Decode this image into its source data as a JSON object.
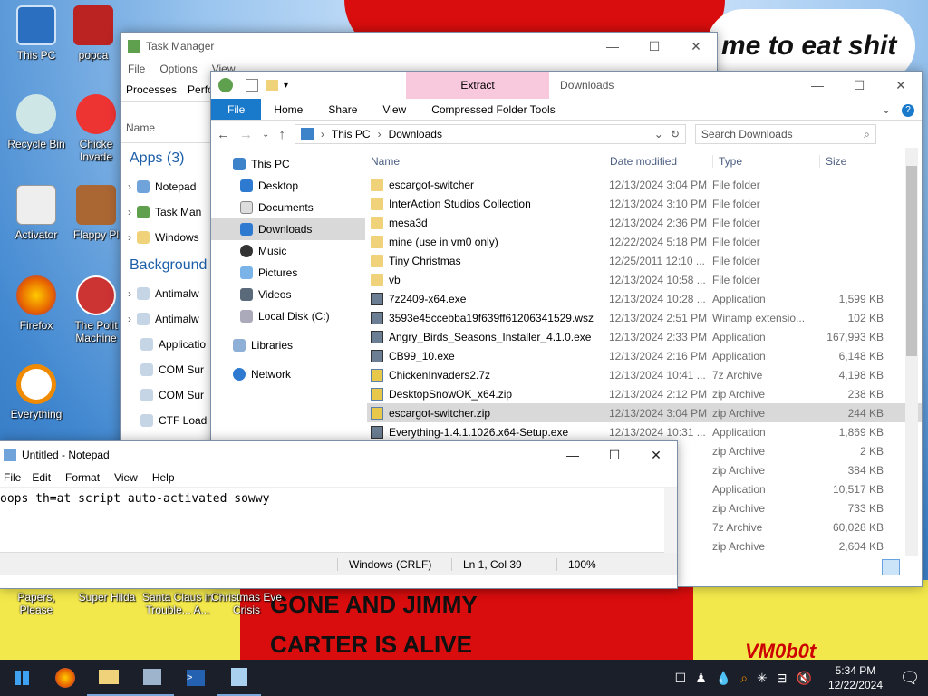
{
  "wallpaper": {
    "top_text": "me to eat shit",
    "line1": "GONE AND JIMMY",
    "line2": "CARTER IS ALIVE",
    "signature": "VM0b0t"
  },
  "desktop_icons": [
    {
      "label": "This PC",
      "icon": "computer-icon",
      "color": "#2b6fc0"
    },
    {
      "label": "popca",
      "icon": "popcap-icon",
      "color": "#b22"
    },
    {
      "label": "Recycle Bin",
      "icon": "recycle-bin-icon",
      "color": "#9cc"
    },
    {
      "label": "Chicke Invade",
      "icon": "chicken-invaders-icon",
      "color": "#e33"
    },
    {
      "label": "Activator",
      "icon": "activator-icon",
      "color": "#ddd"
    },
    {
      "label": "Flappy Pl",
      "icon": "flappy-icon",
      "color": "#a63"
    },
    {
      "label": "Firefox",
      "icon": "firefox-icon",
      "color": "#e66000"
    },
    {
      "label": "The Polit Machine",
      "icon": "political-machine-icon",
      "color": "#c33"
    },
    {
      "label": "Everything",
      "icon": "everything-icon",
      "color": "#f08a00"
    }
  ],
  "bottom_icons": [
    "Papers, Please",
    "Super Hilda",
    "Santa Claus in Trouble... A...",
    "Christmas Eve Crisis"
  ],
  "task_manager": {
    "title": "Task Manager",
    "menu": [
      "File",
      "Options",
      "View"
    ],
    "tabs": [
      "Processes",
      "Perfo"
    ],
    "col_name": "Name",
    "apps_header": "Apps (3)",
    "apps": [
      "Notepad",
      "Task Man",
      "Windows"
    ],
    "bg_header": "Background",
    "bg": [
      "Antimalw",
      "Antimalw",
      "Applicatio",
      "COM Sur",
      "COM Sur",
      "CTF Load"
    ]
  },
  "explorer": {
    "title": "Downloads",
    "context_tab": "Extract",
    "tabs": {
      "file": "File",
      "home": "Home",
      "share": "Share",
      "view": "View",
      "tools": "Compressed Folder Tools"
    },
    "path": [
      "This PC",
      "Downloads"
    ],
    "search_placeholder": "Search Downloads",
    "nav": [
      "This PC",
      "Desktop",
      "Documents",
      "Downloads",
      "Music",
      "Pictures",
      "Videos",
      "Local Disk (C:)",
      "Libraries",
      "Network"
    ],
    "headers": {
      "name": "Name",
      "date": "Date modified",
      "type": "Type",
      "size": "Size"
    },
    "files": [
      {
        "name": "escargot-switcher",
        "date": "12/13/2024 3:04 PM",
        "type": "File folder",
        "size": "",
        "kind": "folder"
      },
      {
        "name": "InterAction Studios Collection",
        "date": "12/13/2024 3:10 PM",
        "type": "File folder",
        "size": "",
        "kind": "folder"
      },
      {
        "name": "mesa3d",
        "date": "12/13/2024 2:36 PM",
        "type": "File folder",
        "size": "",
        "kind": "folder"
      },
      {
        "name": "mine (use in vm0 only)",
        "date": "12/22/2024 5:18 PM",
        "type": "File folder",
        "size": "",
        "kind": "folder"
      },
      {
        "name": "Tiny Christmas",
        "date": "12/25/2011 12:10 ...",
        "type": "File folder",
        "size": "",
        "kind": "folder"
      },
      {
        "name": "vb",
        "date": "12/13/2024 10:58 ...",
        "type": "File folder",
        "size": "",
        "kind": "folder"
      },
      {
        "name": "7z2409-x64.exe",
        "date": "12/13/2024 10:28 ...",
        "type": "Application",
        "size": "1,599 KB",
        "kind": "app"
      },
      {
        "name": "3593e45ccebba19f639ff61206341529.wsz",
        "date": "12/13/2024 2:51 PM",
        "type": "Winamp extensio...",
        "size": "102 KB",
        "kind": "app"
      },
      {
        "name": "Angry_Birds_Seasons_Installer_4.1.0.exe",
        "date": "12/13/2024 2:33 PM",
        "type": "Application",
        "size": "167,993 KB",
        "kind": "app"
      },
      {
        "name": "CB99_10.exe",
        "date": "12/13/2024 2:16 PM",
        "type": "Application",
        "size": "6,148 KB",
        "kind": "app"
      },
      {
        "name": "ChickenInvaders2.7z",
        "date": "12/13/2024 10:41 ...",
        "type": "7z Archive",
        "size": "4,198 KB",
        "kind": "zip"
      },
      {
        "name": "DesktopSnowOK_x64.zip",
        "date": "12/13/2024 2:12 PM",
        "type": "zip Archive",
        "size": "238 KB",
        "kind": "zip"
      },
      {
        "name": "escargot-switcher.zip",
        "date": "12/13/2024 3:04 PM",
        "type": "zip Archive",
        "size": "244 KB",
        "kind": "zip"
      },
      {
        "name": "Everything-1.4.1.1026.x64-Setup.exe",
        "date": "12/13/2024 10:31 ...",
        "type": "Application",
        "size": "1,869 KB",
        "kind": "app"
      },
      {
        "name": "",
        "date": "PM",
        "type": "zip Archive",
        "size": "2 KB",
        "kind": "hidden"
      },
      {
        "name": "",
        "date": "PM",
        "type": "zip Archive",
        "size": "384 KB",
        "kind": "hidden"
      },
      {
        "name": "",
        "date": "M",
        "type": "Application",
        "size": "10,517 KB",
        "kind": "hidden"
      },
      {
        "name": "",
        "date": "PM",
        "type": "zip Archive",
        "size": "733 KB",
        "kind": "hidden"
      },
      {
        "name": "",
        "date": "PM",
        "type": "7z Archive",
        "size": "60,028 KB",
        "kind": "hidden"
      },
      {
        "name": "",
        "date": "PM",
        "type": "zip Archive",
        "size": "2,604 KB",
        "kind": "hidden"
      }
    ]
  },
  "notepad": {
    "title": "Untitled - Notepad",
    "menu": [
      "File",
      "Edit",
      "Format",
      "View",
      "Help"
    ],
    "content": "oops th=at script auto-activated sowwy",
    "status_eol": "Windows (CRLF)",
    "status_pos": "Ln 1, Col 39",
    "status_zoom": "100%"
  },
  "taskbar": {
    "time": "5:34 PM",
    "date": "12/22/2024"
  }
}
